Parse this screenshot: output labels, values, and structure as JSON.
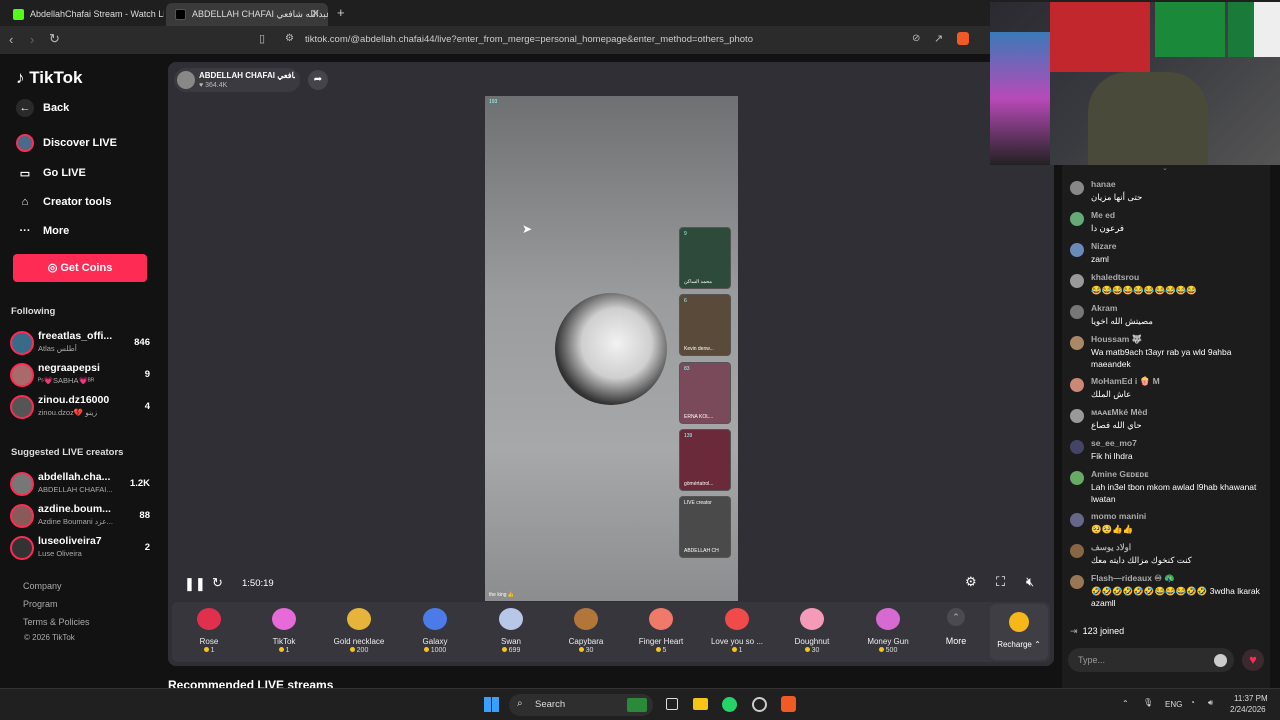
{
  "browser": {
    "tabs": [
      {
        "title": "AbdellahChafai Stream - Watch Live"
      },
      {
        "title": "ABDELLAH CHAFAI عبدالله شافعي"
      }
    ],
    "new_tab": "+",
    "url": "tiktok.com/@abdellah.chafai44/live?enter_from_merge=personal_homepage&enter_method=others_photo"
  },
  "sidebar": {
    "logo": "TikTok",
    "back": "Back",
    "nav": [
      {
        "label": "Discover LIVE"
      },
      {
        "label": "Go LIVE"
      },
      {
        "label": "Creator tools"
      },
      {
        "label": "More"
      }
    ],
    "get_coins": "Get Coins",
    "following_title": "Following",
    "following": [
      {
        "name": "freeatlas_offi...",
        "sub": "Atlas أطلس",
        "count": "846"
      },
      {
        "name": "negraapepsi",
        "sub": "ᴾˢ💗SABHA💗ᴮᴿ",
        "count": "9"
      },
      {
        "name": "zinou.dz16000",
        "sub": "zinou.dzoz💔 زينو",
        "count": "4"
      }
    ],
    "suggested_title": "Suggested LIVE creators",
    "suggested": [
      {
        "name": "abdellah.cha...",
        "sub": "ABDELLAH CHAFAI...",
        "count": "1.2K"
      },
      {
        "name": "azdine.boum...",
        "sub": "Azdine Boumani عزد...",
        "count": "88"
      },
      {
        "name": "luseoliveira7",
        "sub": "Luse Oliveira",
        "count": "2"
      }
    ],
    "footer": [
      "Company",
      "Program",
      "Terms & Policies",
      "© 2026 TikTok"
    ]
  },
  "live": {
    "host_name": "ABDELLAH CHAFAI عبدالله شافعي",
    "host_likes": "364.4K",
    "video_top_badge": "193",
    "video_caption": "the king 👍",
    "tiles": [
      {
        "badge": "9",
        "name": "محمد الساكن"
      },
      {
        "badge": "6",
        "name": "Kevin denw..."
      },
      {
        "badge": "83",
        "name": "ERNA KOL..."
      },
      {
        "badge": "139",
        "name": "gömértatrol..."
      },
      {
        "badge": "LIVE creator",
        "name": "ABDELLAH CH"
      }
    ],
    "time": "1:50:19",
    "gifts": [
      {
        "name": "Rose",
        "price": "1",
        "color": "#e0304e"
      },
      {
        "name": "TikTok",
        "price": "1",
        "color": "#e66ad8"
      },
      {
        "name": "Gold necklace",
        "price": "200",
        "color": "#e6b43a"
      },
      {
        "name": "Galaxy",
        "price": "1000",
        "color": "#4a7be8"
      },
      {
        "name": "Swan",
        "price": "699",
        "color": "#b8c6e8"
      },
      {
        "name": "Capybara",
        "price": "30",
        "color": "#b2763a"
      },
      {
        "name": "Finger Heart",
        "price": "5",
        "color": "#f07a6a"
      },
      {
        "name": "Love you so ...",
        "price": "1",
        "color": "#f04a4a"
      },
      {
        "name": "Doughnut",
        "price": "30",
        "color": "#f59ab8"
      },
      {
        "name": "Money Gun",
        "price": "500",
        "color": "#d66ad0"
      }
    ],
    "more": "More",
    "recharge": "Recharge",
    "recommended": "Recommended LIVE streams"
  },
  "chat": {
    "messages": [
      {
        "user": "hanae",
        "text": "حتى أنها مزيان",
        "color": "#888"
      },
      {
        "user": "Me ed",
        "text": "فرعون دا",
        "color": "#6a7"
      },
      {
        "user": "Nizare",
        "text": "zaml",
        "color": "#6a8ab8"
      },
      {
        "user": "khaledtsrou",
        "text": "😂😂😂😂😂😂😂😂😂😂",
        "color": "#999"
      },
      {
        "user": "Akram",
        "text": "مصيتش الله اخويا",
        "color": "#777"
      },
      {
        "user": "Houssam 🐺",
        "text": "Wa matb9ach t3ayr rab ya wld 9ahba maeandek",
        "color": "#a86"
      },
      {
        "user": "MoHamEd i 🍿 M",
        "text": "عاش الملك",
        "color": "#c87"
      },
      {
        "user": "ᴍᴀᴀᴇMké Mèd",
        "text": "حاي الله فصاع",
        "color": "#999"
      },
      {
        "user": "se_ee_mo7",
        "text": "Fik hi lhdra",
        "color": "#446"
      },
      {
        "user": "Amine Gᴇᴅᴇᴅᴇ",
        "text": "Lah in3el tbon mkom awlad l9hab khawanat lwatan",
        "color": "#6a6"
      },
      {
        "user": "momo manini",
        "text": "🥺🥺👍👍",
        "color": "#668"
      },
      {
        "user": "اولاد يوسف",
        "text": "كنت كنخوك مزالك دايته معك",
        "color": "#864"
      },
      {
        "user": "Flash—rideaux ♾ 🦚",
        "text": "🤣🤣🤣🤣🤣🤣😂😂😂🤣🤣 3wdha lkarak azamll",
        "color": "#975"
      }
    ],
    "joined": "123  joined",
    "input_placeholder": "Type..."
  },
  "taskbar": {
    "search": "Search",
    "lang": "ENG",
    "time": "11:37 PM",
    "date": "2/24/2026"
  }
}
